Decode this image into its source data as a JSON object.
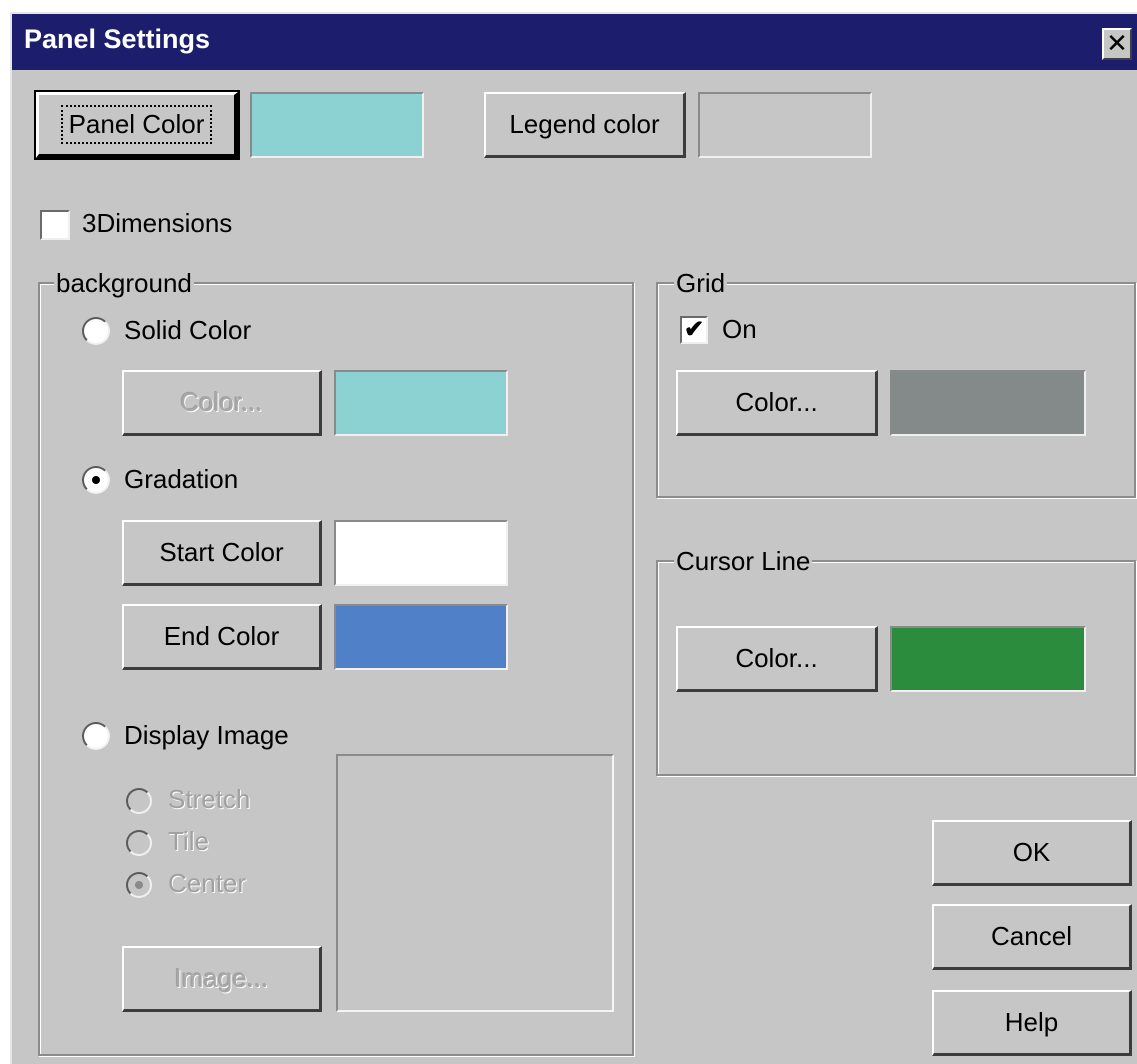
{
  "window": {
    "title": "Panel Settings",
    "close_glyph": "✕"
  },
  "top": {
    "panel_color_label": "Panel Color",
    "panel_color_value": "#8cd2d2",
    "legend_color_label": "Legend color",
    "legend_color_value": "#c6c6c6"
  },
  "three_d": {
    "label": "3Dimensions",
    "checked": false
  },
  "background": {
    "group_label": "background",
    "solid": {
      "label": "Solid Color",
      "selected": false,
      "button_label": "Color...",
      "color": "#8cd2d2"
    },
    "gradation": {
      "label": "Gradation",
      "selected": true,
      "start_label": "Start Color",
      "start_color": "#ffffff",
      "end_label": "End Color",
      "end_color": "#5080c8"
    },
    "display_image": {
      "label": "Display Image",
      "selected": false,
      "options": [
        "Stretch",
        "Tile",
        "Center"
      ],
      "selected_option": "Center",
      "image_button_label": "Image..."
    }
  },
  "grid": {
    "group_label": "Grid",
    "on_label": "On",
    "on_checked": true,
    "check_glyph": "✔",
    "button_label": "Color...",
    "color": "#848a8a"
  },
  "cursor_line": {
    "group_label": "Cursor Line",
    "button_label": "Color...",
    "color": "#2a8c3c"
  },
  "actions": {
    "ok": "OK",
    "cancel": "Cancel",
    "help": "Help"
  }
}
